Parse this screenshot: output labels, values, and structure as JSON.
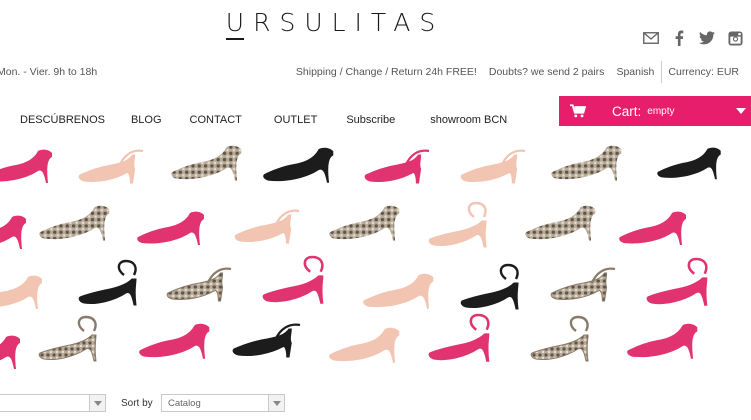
{
  "brand": {
    "logo_first": "U",
    "logo_rest": "RSULITAS"
  },
  "social": [
    {
      "icon": "mail-icon",
      "label": "Mail"
    },
    {
      "icon": "facebook-icon",
      "label": "Facebook"
    },
    {
      "icon": "twitter-icon",
      "label": "Twitter"
    },
    {
      "icon": "instagram-icon",
      "label": "Instagram"
    }
  ],
  "infobar": {
    "hours": "Mon. - Vier. 9h to 18h",
    "shipping": "Shipping / Change / Return 24h FREE!",
    "doubts": "Doubts? we send 2 pairs",
    "language": "Spanish",
    "currency": "Currency: EUR"
  },
  "nav": [
    "DESCÚBRENOS",
    "BLOG",
    "CONTACT",
    "OUTLET",
    "Subscribe",
    "showroom BCN"
  ],
  "cart": {
    "label": "Cart:",
    "status": "empty",
    "color": "#e61e6c"
  },
  "filters": {
    "sort_label": "Sort by",
    "sort_value": "Catalog",
    "first_value": ""
  },
  "colors": {
    "pink": "#e0336f",
    "nude": "#f2c4b2",
    "black": "#1c1c1c",
    "snake": "#9a8a7a",
    "gold": "#c8b58a"
  }
}
